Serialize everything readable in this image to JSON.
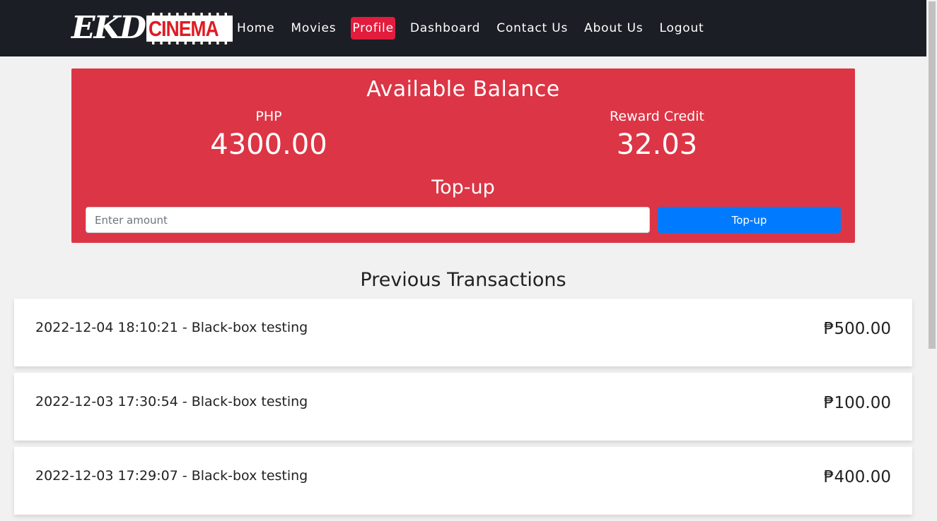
{
  "logo": {
    "part1": "EKD",
    "part2": "CINEMA"
  },
  "nav": [
    {
      "label": "Home",
      "active": false
    },
    {
      "label": "Movies",
      "active": false
    },
    {
      "label": "Profile",
      "active": true
    },
    {
      "label": "Dashboard",
      "active": false
    },
    {
      "label": "Contact Us",
      "active": false
    },
    {
      "label": "About Us",
      "active": false
    },
    {
      "label": "Logout",
      "active": false
    }
  ],
  "balance": {
    "title": "Available Balance",
    "php_label": "PHP",
    "php_value": "4300.00",
    "reward_label": "Reward Credit",
    "reward_value": "32.03",
    "topup_title": "Top-up",
    "topup_placeholder": "Enter amount",
    "topup_button": "Top-up"
  },
  "transactions": {
    "heading": "Previous Transactions",
    "items": [
      {
        "desc": "2022-12-04 18:10:21 - Black-box testing",
        "amount": "₱500.00"
      },
      {
        "desc": "2022-12-03 17:30:54 - Black-box testing",
        "amount": "₱100.00"
      },
      {
        "desc": "2022-12-03 17:29:07 - Black-box testing",
        "amount": "₱400.00"
      }
    ]
  },
  "colors": {
    "navbar": "#1b1e25",
    "accent_red": "#dc3545",
    "active_nav": "#e21c3d",
    "button_blue": "#007bff"
  }
}
